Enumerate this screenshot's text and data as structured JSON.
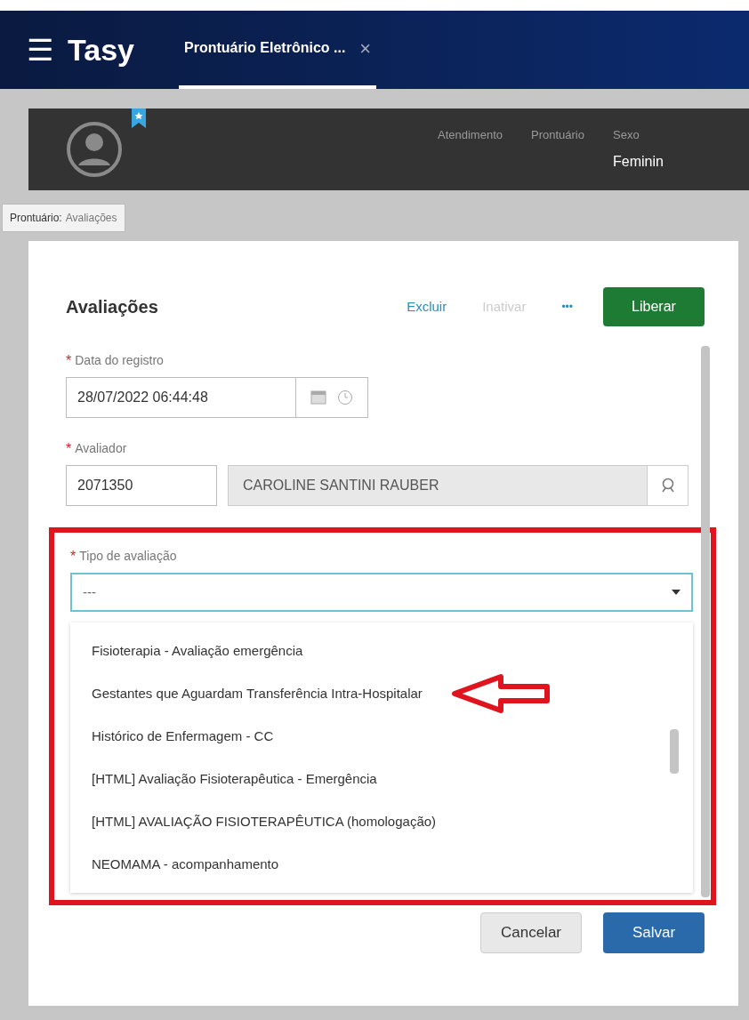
{
  "app": {
    "menu_glyph": "☰",
    "name": "Tasy"
  },
  "tabs": [
    {
      "label": "Prontuário Eletrônico ...",
      "close": "×",
      "selected": true
    }
  ],
  "patient_bar": {
    "fields": [
      {
        "label": "Atendimento"
      },
      {
        "label": "Prontuário"
      },
      {
        "label": "Sexo",
        "value": "Feminin"
      }
    ]
  },
  "breadcrumb": {
    "section": "Prontuário:",
    "page": "Avaliações"
  },
  "panel": {
    "title": "Avaliações",
    "actions": [
      {
        "label": "Excluir",
        "disabled": false
      },
      {
        "label": "Inativar",
        "disabled": true
      }
    ],
    "more": "•••",
    "primary": "Liberar",
    "fields": [
      {
        "kind": "datetime",
        "label": "Data do registro",
        "required_mark": "*",
        "value": "28/07/2022 06:44:48"
      },
      {
        "kind": "lookup",
        "label": "Avaliador",
        "required_mark": "*",
        "code": "2071350",
        "value": "CAROLINE SANTINI RAUBER"
      },
      {
        "kind": "select",
        "label": "Tipo de avaliação",
        "required_mark": "*",
        "value": "---",
        "highlighted": true,
        "options": [
          {
            "label": "Fisioterapia - Avaliação emergência",
            "pointed": false
          },
          {
            "label": "Gestantes que Aguardam Transferência Intra-Hospitalar",
            "pointed": true
          },
          {
            "label": "Histórico de Enfermagem - CC",
            "pointed": false
          },
          {
            "label": "[HTML] Avaliação Fisioterapêutica - Emergência",
            "pointed": false
          },
          {
            "label": "[HTML] AVALIAÇÃO FISIOTERAPÊUTICA (homologação)",
            "pointed": false
          },
          {
            "label": "NEOMAMA - acompanhamento",
            "pointed": false
          }
        ]
      }
    ],
    "buttons": [
      {
        "label": "Cancelar",
        "kind": "secondary"
      },
      {
        "label": "Salvar",
        "kind": "primary"
      }
    ]
  }
}
